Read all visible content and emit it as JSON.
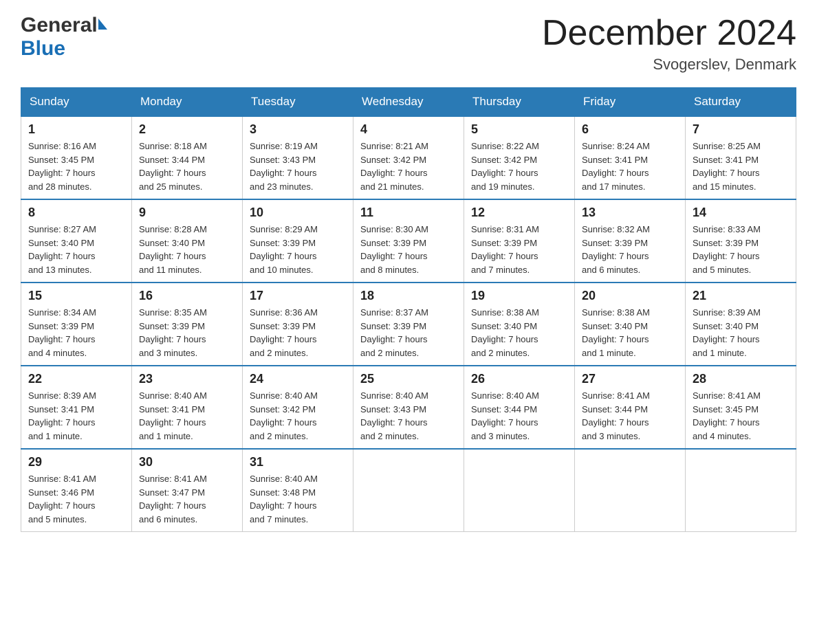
{
  "header": {
    "logo_general": "General",
    "logo_blue": "Blue",
    "title": "December 2024",
    "location": "Svogerslev, Denmark"
  },
  "days_of_week": [
    "Sunday",
    "Monday",
    "Tuesday",
    "Wednesday",
    "Thursday",
    "Friday",
    "Saturday"
  ],
  "weeks": [
    [
      {
        "day": "1",
        "sunrise": "8:16 AM",
        "sunset": "3:45 PM",
        "daylight": "7 hours and 28 minutes."
      },
      {
        "day": "2",
        "sunrise": "8:18 AM",
        "sunset": "3:44 PM",
        "daylight": "7 hours and 25 minutes."
      },
      {
        "day": "3",
        "sunrise": "8:19 AM",
        "sunset": "3:43 PM",
        "daylight": "7 hours and 23 minutes."
      },
      {
        "day": "4",
        "sunrise": "8:21 AM",
        "sunset": "3:42 PM",
        "daylight": "7 hours and 21 minutes."
      },
      {
        "day": "5",
        "sunrise": "8:22 AM",
        "sunset": "3:42 PM",
        "daylight": "7 hours and 19 minutes."
      },
      {
        "day": "6",
        "sunrise": "8:24 AM",
        "sunset": "3:41 PM",
        "daylight": "7 hours and 17 minutes."
      },
      {
        "day": "7",
        "sunrise": "8:25 AM",
        "sunset": "3:41 PM",
        "daylight": "7 hours and 15 minutes."
      }
    ],
    [
      {
        "day": "8",
        "sunrise": "8:27 AM",
        "sunset": "3:40 PM",
        "daylight": "7 hours and 13 minutes."
      },
      {
        "day": "9",
        "sunrise": "8:28 AM",
        "sunset": "3:40 PM",
        "daylight": "7 hours and 11 minutes."
      },
      {
        "day": "10",
        "sunrise": "8:29 AM",
        "sunset": "3:39 PM",
        "daylight": "7 hours and 10 minutes."
      },
      {
        "day": "11",
        "sunrise": "8:30 AM",
        "sunset": "3:39 PM",
        "daylight": "7 hours and 8 minutes."
      },
      {
        "day": "12",
        "sunrise": "8:31 AM",
        "sunset": "3:39 PM",
        "daylight": "7 hours and 7 minutes."
      },
      {
        "day": "13",
        "sunrise": "8:32 AM",
        "sunset": "3:39 PM",
        "daylight": "7 hours and 6 minutes."
      },
      {
        "day": "14",
        "sunrise": "8:33 AM",
        "sunset": "3:39 PM",
        "daylight": "7 hours and 5 minutes."
      }
    ],
    [
      {
        "day": "15",
        "sunrise": "8:34 AM",
        "sunset": "3:39 PM",
        "daylight": "7 hours and 4 minutes."
      },
      {
        "day": "16",
        "sunrise": "8:35 AM",
        "sunset": "3:39 PM",
        "daylight": "7 hours and 3 minutes."
      },
      {
        "day": "17",
        "sunrise": "8:36 AM",
        "sunset": "3:39 PM",
        "daylight": "7 hours and 2 minutes."
      },
      {
        "day": "18",
        "sunrise": "8:37 AM",
        "sunset": "3:39 PM",
        "daylight": "7 hours and 2 minutes."
      },
      {
        "day": "19",
        "sunrise": "8:38 AM",
        "sunset": "3:40 PM",
        "daylight": "7 hours and 2 minutes."
      },
      {
        "day": "20",
        "sunrise": "8:38 AM",
        "sunset": "3:40 PM",
        "daylight": "7 hours and 1 minute."
      },
      {
        "day": "21",
        "sunrise": "8:39 AM",
        "sunset": "3:40 PM",
        "daylight": "7 hours and 1 minute."
      }
    ],
    [
      {
        "day": "22",
        "sunrise": "8:39 AM",
        "sunset": "3:41 PM",
        "daylight": "7 hours and 1 minute."
      },
      {
        "day": "23",
        "sunrise": "8:40 AM",
        "sunset": "3:41 PM",
        "daylight": "7 hours and 1 minute."
      },
      {
        "day": "24",
        "sunrise": "8:40 AM",
        "sunset": "3:42 PM",
        "daylight": "7 hours and 2 minutes."
      },
      {
        "day": "25",
        "sunrise": "8:40 AM",
        "sunset": "3:43 PM",
        "daylight": "7 hours and 2 minutes."
      },
      {
        "day": "26",
        "sunrise": "8:40 AM",
        "sunset": "3:44 PM",
        "daylight": "7 hours and 3 minutes."
      },
      {
        "day": "27",
        "sunrise": "8:41 AM",
        "sunset": "3:44 PM",
        "daylight": "7 hours and 3 minutes."
      },
      {
        "day": "28",
        "sunrise": "8:41 AM",
        "sunset": "3:45 PM",
        "daylight": "7 hours and 4 minutes."
      }
    ],
    [
      {
        "day": "29",
        "sunrise": "8:41 AM",
        "sunset": "3:46 PM",
        "daylight": "7 hours and 5 minutes."
      },
      {
        "day": "30",
        "sunrise": "8:41 AM",
        "sunset": "3:47 PM",
        "daylight": "7 hours and 6 minutes."
      },
      {
        "day": "31",
        "sunrise": "8:40 AM",
        "sunset": "3:48 PM",
        "daylight": "7 hours and 7 minutes."
      },
      null,
      null,
      null,
      null
    ]
  ],
  "labels": {
    "sunrise": "Sunrise:",
    "sunset": "Sunset:",
    "daylight": "Daylight:"
  }
}
